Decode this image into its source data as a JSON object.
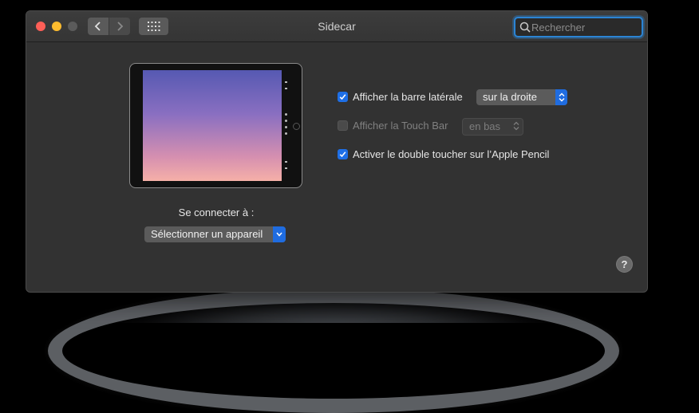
{
  "window": {
    "title": "Sidecar"
  },
  "toolbar": {
    "search_placeholder": "Rechercher",
    "back_icon": "chevron-left-icon",
    "forward_icon": "chevron-right-icon",
    "grid_icon": "grid-icon"
  },
  "device": {
    "connect_label": "Se connecter à :",
    "select_value": "Sélectionner un appareil"
  },
  "options": {
    "sidebar": {
      "label": "Afficher la barre latérale",
      "checked": true,
      "popup_value": "sur la droite"
    },
    "touchbar": {
      "label": "Afficher la Touch Bar",
      "checked": false,
      "enabled": false,
      "popup_value": "en bas"
    },
    "pencil": {
      "label": "Activer le double toucher sur l’Apple Pencil",
      "checked": true
    }
  },
  "help": {
    "label": "?"
  },
  "colors": {
    "accent": "#1e6fe6",
    "close": "#fe5f57",
    "minimize": "#febc2e",
    "window_bg": "#323232"
  }
}
